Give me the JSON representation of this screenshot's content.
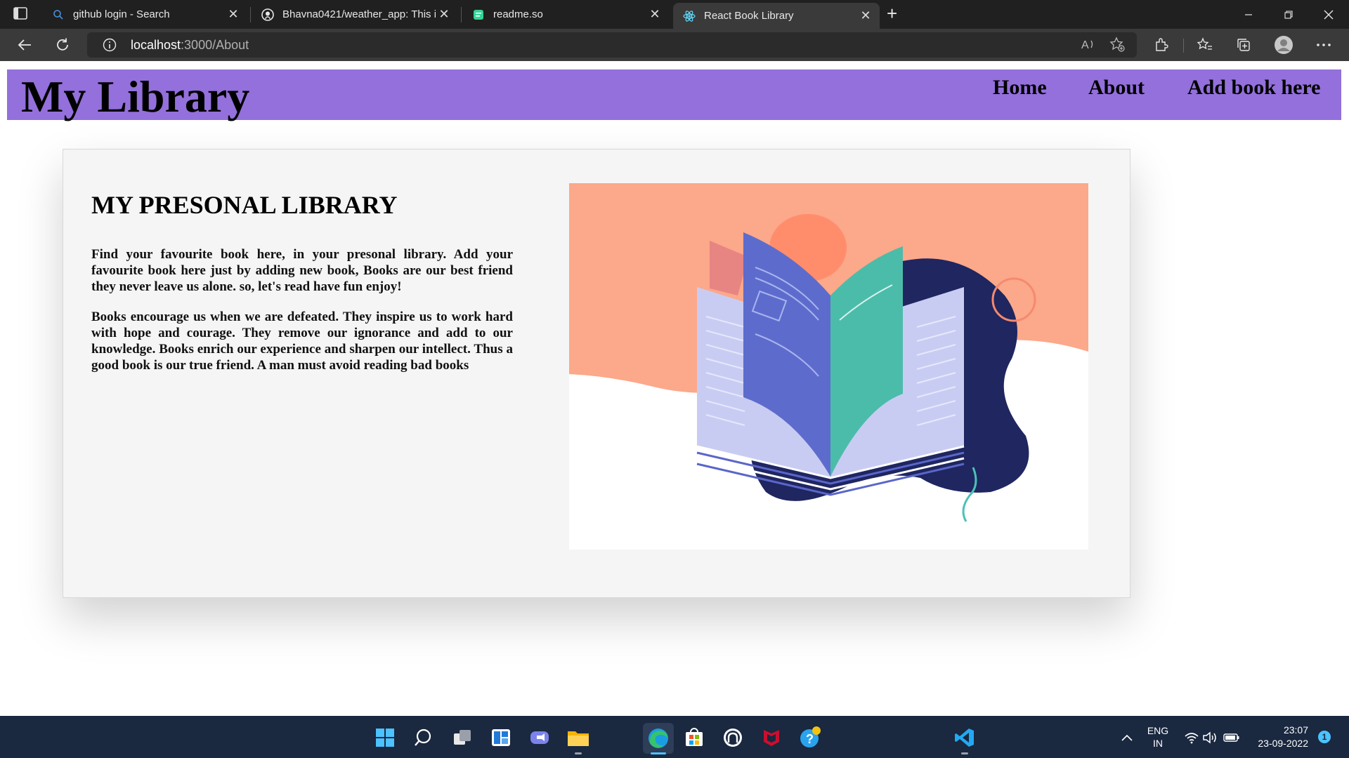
{
  "browser": {
    "tabs": [
      {
        "title": "github login - Search",
        "icon": "search-icon"
      },
      {
        "title": "Bhavna0421/weather_app: This i",
        "icon": "github-icon"
      },
      {
        "title": "readme.so",
        "icon": "readme-icon"
      },
      {
        "title": "React Book Library",
        "icon": "react-icon",
        "active": true
      }
    ],
    "url_host": "localhost",
    "url_path": ":3000/About"
  },
  "navbar": {
    "brand": "My Library",
    "links": [
      "Home",
      "About",
      "Add book here"
    ],
    "background": "#9370db"
  },
  "about": {
    "heading": "MY PRESONAL LIBRARY",
    "paragraph1": "Find your favourite book here, in your presonal library. Add your favourite book here just by adding new book, Books are our best friend they never leave us alone. so, let's read have fun enjoy!",
    "paragraph2": "Books encourage us when we are defeated. They inspire us to work hard with hope and courage. They remove our ignorance and add to our knowledge. Books enrich our experience and sharpen our intellect. Thus a good book is our true friend. A man must avoid reading bad books"
  },
  "taskbar": {
    "language_line1": "ENG",
    "language_line2": "IN",
    "time": "23:07",
    "date": "23-09-2022",
    "notification_count": "1"
  }
}
